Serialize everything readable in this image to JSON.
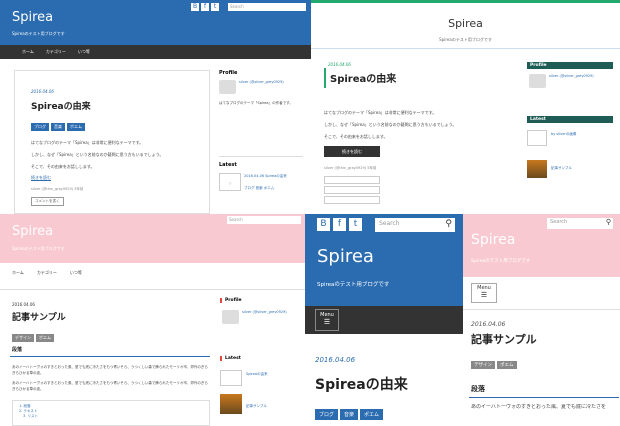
{
  "colors": {
    "blue": "#2b6cb0",
    "dark": "#333333",
    "pink": "#f9c9d1",
    "green": "#23a86d",
    "teal": "#1e5c55",
    "red": "#e8483b"
  },
  "p1": {
    "site_title": "Spirea",
    "tagline": "Spireaのテスト用ブログです",
    "search_placeholder": "Search",
    "nav": [
      "ホーム",
      "カテゴリー",
      "いつ等"
    ],
    "post": {
      "date": "2016.04.06",
      "title": "Spireaの由来",
      "tags": [
        "ブログ",
        "音楽",
        "ポエム"
      ],
      "body": [
        "はてなブログのテーマ「Spirea」は非常に便利なテーマです。",
        "しかし、なぜ「Spirea」という名前なのか疑問に思う方もいるでしょう。",
        "そこで、その由来をお話しします。"
      ],
      "readmore": "続きを読む",
      "meta": "silver (@thin_gray0929) 5年前",
      "comment": "コメントを書く"
    },
    "sidebar": {
      "profile": "Profile",
      "user": "silver (@silver_grey0929)",
      "desc": "はてなブログのテーマ「Spirea」の作者です。",
      "latest": "Latest",
      "latest_item": "2016.04.06 Spireaの由来",
      "latest_tags": "ブログ 音楽 ポエム"
    }
  },
  "p2": {
    "site_title": "Spirea",
    "tagline": "Spireaのテスト用ブログです",
    "post": {
      "date": "2016.04.06",
      "title": "Spireaの由来",
      "body": [
        "はてなブログのテーマ「Spirea」は非常に便利なテーマです。",
        "しかし、なぜ「Spirea」という名前なのか疑問に思う方もいるでしょう。",
        "そこで、その由来をお話しします。"
      ],
      "readmore": "続きを読む",
      "meta": "silver (@thin_gray0929) 5年前"
    },
    "sidebar": {
      "profile": "Profile",
      "user": "silver (@silver_grey0929)",
      "latest": "Latest",
      "latest_item1": "by silverの画像",
      "latest_item2": "記事サンプル"
    }
  },
  "p3": {
    "site_title": "Spirea",
    "tagline": "Spireaのテスト用ブログです",
    "search_placeholder": "Search",
    "nav": [
      "ホーム",
      "カテゴリー",
      "いつ等"
    ],
    "post": {
      "date": "2016.04.06",
      "title": "記事サンプル",
      "tags": [
        "デザイン",
        "ポエム"
      ],
      "heading": "段落",
      "body": [
        "あのイーハトーヴォのすきとおった風、夏でも底に冷たさをもつ青いそら、うつくしい森で飾られたモーリオ市、郊外のぎらぎらひかる草の波。",
        "あのイーハトーヴォのすきとおった風、夏でも底に冷たさをもつ青いそら、うつくしい森で飾られたモーリオ市、郊外のぎらぎらひかる草の波。"
      ],
      "toc": [
        "1. 段落",
        "2. テキスト",
        "3. リスト"
      ]
    },
    "sidebar": {
      "profile": "Profile",
      "user": "silver (@silver_grey0929)",
      "latest": "Latest",
      "latest_item1": "Spireaの由来",
      "latest_item2": "記事サンプル"
    }
  },
  "p4": {
    "search_placeholder": "Search",
    "site_title": "Spirea",
    "tagline": "Spireaのテスト用ブログです",
    "menu": "Menu",
    "post": {
      "date": "2016.04.06",
      "title": "Spireaの由来",
      "tags": [
        "ブログ",
        "音楽",
        "ポエム"
      ]
    }
  },
  "p5": {
    "search_placeholder": "Search",
    "site_title": "Spirea",
    "tagline": "Spireaのテスト用ブログです",
    "menu": "Menu",
    "post": {
      "date": "2016.04.06",
      "title": "記事サンプル",
      "tags": [
        "デザイン",
        "ポエム"
      ],
      "heading": "段落",
      "body": "あのイーハトーヴォのすきとおった風、夏でも底に冷たさを"
    }
  }
}
